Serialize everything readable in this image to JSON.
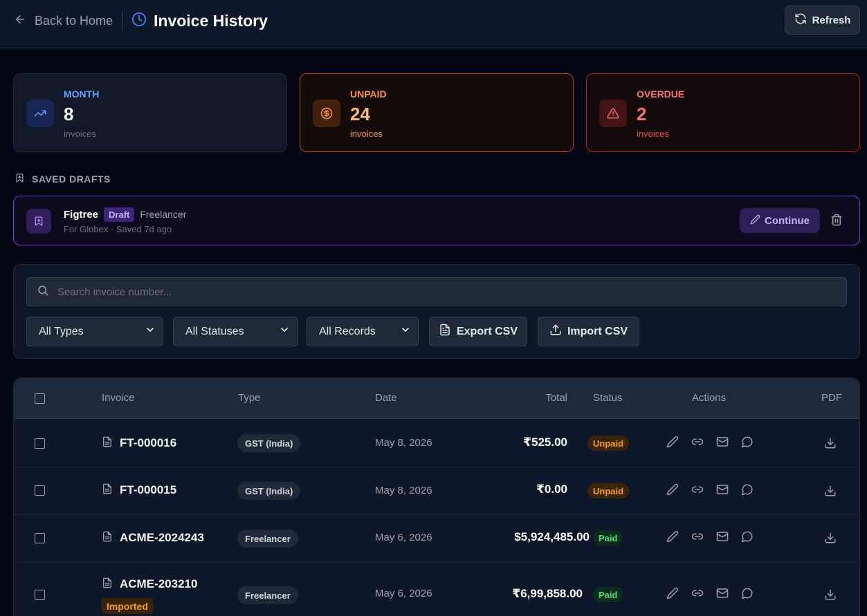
{
  "header": {
    "back_label": "Back to Home",
    "title": "Invoice History",
    "refresh_label": "Refresh"
  },
  "stats": {
    "month": {
      "label": "MONTH",
      "value": "8",
      "sub": "invoices"
    },
    "unpaid": {
      "label": "UNPAID",
      "value": "24",
      "sub": "invoices"
    },
    "overdue": {
      "label": "OVERDUE",
      "value": "2",
      "sub": "invoices"
    }
  },
  "drafts": {
    "heading": "SAVED DRAFTS",
    "items": [
      {
        "name": "Figtree",
        "badge": "Draft",
        "type": "Freelancer",
        "sub": "For Globex · Saved 7d ago",
        "continue_label": "Continue"
      }
    ]
  },
  "filters": {
    "search_placeholder": "Search invoice number...",
    "type_select": "All Types",
    "status_select": "All Statuses",
    "records_select": "All Records",
    "export_label": "Export CSV",
    "import_label": "Import CSV"
  },
  "table": {
    "columns": {
      "invoice": "Invoice",
      "type": "Type",
      "date": "Date",
      "total": "Total",
      "status": "Status",
      "actions": "Actions",
      "pdf": "PDF"
    },
    "rows": [
      {
        "number": "FT-000016",
        "type": "GST (India)",
        "date": "May 8, 2026",
        "total": "₹525.00",
        "status": "Unpaid",
        "tag": ""
      },
      {
        "number": "FT-000015",
        "type": "GST (India)",
        "date": "May 8, 2026",
        "total": "₹0.00",
        "status": "Unpaid",
        "tag": ""
      },
      {
        "number": "ACME-2024243",
        "type": "Freelancer",
        "date": "May 6, 2026",
        "total": "$5,924,485.00",
        "status": "Paid",
        "tag": ""
      },
      {
        "number": "ACME-203210",
        "type": "Freelancer",
        "date": "May 6, 2026",
        "total": "₹6,99,858.00",
        "status": "Paid",
        "tag": "Imported"
      }
    ]
  },
  "colors": {
    "background": "#030712",
    "accent_blue": "#3b82f6",
    "unpaid_orange": "#f59e0b",
    "overdue_red": "#f87171",
    "draft_purple": "#7c3aed",
    "paid_green": "#4ade80"
  }
}
